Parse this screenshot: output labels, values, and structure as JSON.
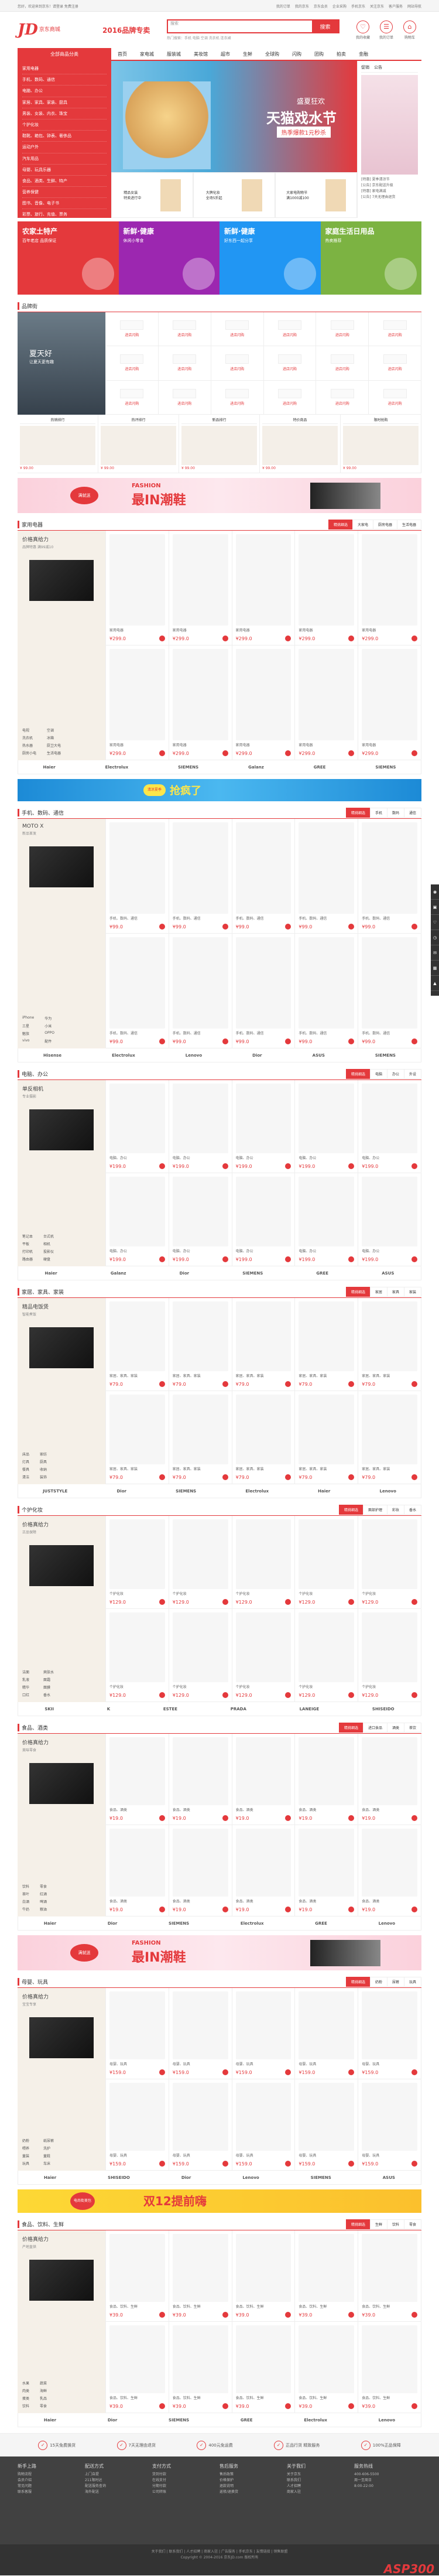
{
  "topbar": {
    "left": "您好，欢迎来到京东！请登录  免费注册",
    "right": [
      "我的订单",
      "我的京东",
      "京东会员",
      "企业采购",
      "手机京东",
      "关注京东",
      "客户服务",
      "网站导航"
    ]
  },
  "header": {
    "logo": "JD",
    "logo_sub": "京东商城",
    "slogan": "2016品牌专卖",
    "search_placeholder": "搜索",
    "search_button": "搜索",
    "hot": "热门搜索：手机 电脑 空调 洗衣机 连衣裙",
    "icons": [
      {
        "g": "♡",
        "t": "我的收藏"
      },
      {
        "g": "☰",
        "t": "我的订单"
      },
      {
        "g": "⌂",
        "t": "购物车"
      }
    ]
  },
  "nav": {
    "all": "全部商品分类",
    "items": [
      "首页",
      "家电城",
      "服装城",
      "美妆馆",
      "超市",
      "生鲜",
      "全球购",
      "闪购",
      "团购",
      "拍卖",
      "金融"
    ]
  },
  "cats": [
    "家用电器",
    "手机、数码、通信",
    "电脑、办公",
    "家居、家具、家装、厨具",
    "男装、女装、内衣、珠宝",
    "个护化妆",
    "鞋靴、箱包、钟表、奢侈品",
    "运动户外",
    "汽车用品",
    "母婴、玩具乐器",
    "食品、酒类、生鲜、特产",
    "营养保健",
    "图书、音像、电子书",
    "彩票、旅行、充值、票务"
  ],
  "banner": {
    "t1": "盛夏狂欢",
    "t2": "天猫戏水节",
    "t3": "热季爆款1元秒杀"
  },
  "thumbs": [
    {
      "t": "精品女装",
      "s": "特卖进行中"
    },
    {
      "t": "大牌化妆",
      "s": "全场5折起"
    },
    {
      "t": "大家电购物节",
      "s": "满1000减100"
    }
  ],
  "side": {
    "tabs": [
      "促销",
      "公告"
    ],
    "news": [
      "[特惠] 夏季清凉节",
      "[公告] 京东配送升级",
      "[特惠] 家电满减",
      "[公告] 7天无理由退货"
    ]
  },
  "promos": [
    {
      "t": "农家土特产",
      "s": "百年老店 品质保证",
      "c": "#e4393c"
    },
    {
      "t": "新鲜·健康",
      "s": "休闲小零食",
      "c": "#9c27b0"
    },
    {
      "t": "新鲜·健康",
      "s": "好东西一起分享",
      "c": "#2196f3"
    },
    {
      "t": "家庭生活日用品",
      "s": "热卖推荐",
      "c": "#7cb342"
    }
  ],
  "brand": {
    "title": "品牌街",
    "left_big": "夏天好",
    "left_sub": "让夏天更有趣",
    "cell": "进店闪购"
  },
  "rank": {
    "tabs": [
      "热销排行",
      "热评排行",
      "新品排行",
      "特价商品",
      "限时抢购"
    ],
    "price": "¥ 99.00"
  },
  "ad1": {
    "badge": "满就送",
    "a": "FASHION",
    "b": "最IN潮鞋"
  },
  "floors": [
    {
      "no": "1F",
      "name": "家用电器",
      "left": "价格真给力",
      "sub": "品牌特惠 满99减10",
      "tabs": [
        "精挑细选",
        "大家电",
        "厨房电器",
        "生活电器"
      ],
      "kw": [
        "电视",
        "空调",
        "洗衣机",
        "冰箱",
        "热水器",
        "厨卫大电",
        "厨房小电",
        "生活电器"
      ],
      "price": "¥299.0",
      "logos": [
        "Haier",
        "Electrolux",
        "SIEMENS",
        "Galanz",
        "GREE",
        "SIEMENS"
      ]
    },
    {
      "no": "2F",
      "name": "手机、数码、通信",
      "left": "MOTO X",
      "sub": "新品首发",
      "tabs": [
        "精挑细选",
        "手机",
        "数码",
        "通信"
      ],
      "kw": [
        "iPhone",
        "华为",
        "三星",
        "小米",
        "魅族",
        "OPPO",
        "vivo",
        "配件"
      ],
      "price": "¥99.0",
      "logos": [
        "Hisense",
        "Electrolux",
        "Lenovo",
        "Dior",
        "ASUS",
        "SIEMENS"
      ]
    },
    {
      "no": "3F",
      "name": "电脑、办公",
      "left": "单反相机",
      "sub": "专业摄影",
      "tabs": [
        "精挑细选",
        "电脑",
        "办公",
        "外设"
      ],
      "kw": [
        "笔记本",
        "台式机",
        "平板",
        "相机",
        "打印机",
        "投影仪",
        "路由器",
        "硬盘"
      ],
      "price": "¥199.0",
      "logos": [
        "Haier",
        "Galanz",
        "Dior",
        "SIEMENS",
        "GREE",
        "ASUS"
      ]
    },
    {
      "no": "4F",
      "name": "家居、家具、家装",
      "left": "精品电饭煲",
      "sub": "智能煮饭",
      "tabs": [
        "精挑细选",
        "家居",
        "家具",
        "家装"
      ],
      "kw": [
        "床品",
        "家纺",
        "灯具",
        "厨具",
        "餐具",
        "收纳",
        "清洁",
        "装饰"
      ],
      "price": "¥79.0",
      "logos": [
        "JUSTSTYLE",
        "Dior",
        "SIEMENS",
        "Electrolux",
        "Haier",
        "Lenovo"
      ]
    },
    {
      "no": "5F",
      "name": "个护化妆",
      "left": "价格真给力",
      "sub": "正品保障",
      "tabs": [
        "精挑细选",
        "面部护理",
        "彩妆",
        "香水"
      ],
      "kw": [
        "洁面",
        "爽肤水",
        "乳液",
        "面霜",
        "精华",
        "面膜",
        "口红",
        "香水"
      ],
      "price": "¥129.0",
      "logos": [
        "SKII",
        "K",
        "ESTEE",
        "PRADA",
        "LANEIGE",
        "SHISEIDO"
      ]
    },
    {
      "no": "6F",
      "name": "食品、酒类",
      "left": "价格真给力",
      "sub": "美味零食",
      "tabs": [
        "精挑细选",
        "进口食品",
        "酒类",
        "茶饮"
      ],
      "kw": [
        "饮料",
        "零食",
        "茶叶",
        "红酒",
        "白酒",
        "啤酒",
        "牛奶",
        "粮油"
      ],
      "price": "¥19.0",
      "logos": [
        "Haier",
        "Dior",
        "SIEMENS",
        "Electrolux",
        "GREE",
        "Lenovo"
      ]
    },
    {
      "no": "7F",
      "name": "母婴、玩具",
      "left": "价格真给力",
      "sub": "宝宝专享",
      "tabs": [
        "精挑细选",
        "奶粉",
        "尿裤",
        "玩具"
      ],
      "kw": [
        "奶粉",
        "纸尿裤",
        "喂养",
        "洗护",
        "童装",
        "童鞋",
        "玩具",
        "车床"
      ],
      "price": "¥159.0",
      "logos": [
        "Haier",
        "SHISEIDO",
        "Dior",
        "Lenovo",
        "SIEMENS",
        "ASUS"
      ]
    },
    {
      "no": "8F",
      "name": "食品、饮料、生鲜",
      "left": "价格真给力",
      "sub": "产地直供",
      "tabs": [
        "精挑细选",
        "生鲜",
        "饮料",
        "零食"
      ],
      "kw": [
        "水果",
        "蔬菜",
        "肉类",
        "海鲜",
        "蛋类",
        "乳品",
        "饮料",
        "零食"
      ],
      "price": "¥39.0",
      "logos": [
        "Haier",
        "Dior",
        "SIEMENS",
        "GREE",
        "Electrolux",
        "Lenovo"
      ]
    }
  ],
  "banner2": {
    "a": "抢疯了",
    "b": "清凉夏季"
  },
  "banner3": {
    "a": "双12提前嗨",
    "b": "电尚街美包"
  },
  "svc": [
    "15天免费换货",
    "7天无理由退货",
    "400元免运费",
    "正品行货 精致服务",
    "100%正品保障"
  ],
  "foot": [
    {
      "h": "新手上路",
      "l": [
        "购物流程",
        "会员介绍",
        "常见问题",
        "联系客服"
      ]
    },
    {
      "h": "配送方式",
      "l": [
        "上门自提",
        "211限时达",
        "配送服务查询",
        "海外配送"
      ]
    },
    {
      "h": "支付方式",
      "l": [
        "货到付款",
        "在线支付",
        "分期付款",
        "公司转账"
      ]
    },
    {
      "h": "售后服务",
      "l": [
        "售后政策",
        "价格保护",
        "退款说明",
        "返修/退换货"
      ]
    },
    {
      "h": "关于我们",
      "l": [
        "关于京东",
        "联系我们",
        "人才招聘",
        "商家入驻"
      ]
    },
    {
      "h": "服务热线",
      "l": [
        "400-606-5500",
        "周一至周日",
        "8:00-22:00"
      ]
    }
  ],
  "copy": [
    "关于我们 | 联系我们 | 人才招聘 | 商家入驻 | 广告服务 | 手机京东 | 友情链接 | 销售联盟",
    "Copyright © 2004-2016 京东JD.com 版权所有"
  ],
  "asp": "ASP300"
}
